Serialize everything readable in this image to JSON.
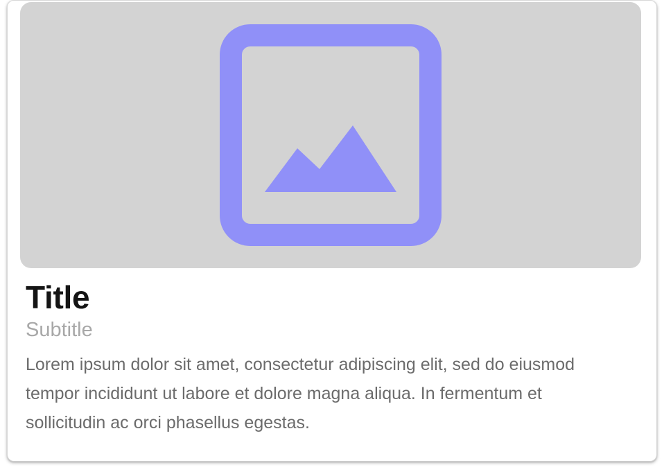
{
  "card": {
    "title": "Title",
    "subtitle": "Subtitle",
    "body": "Lorem ipsum dolor sit amet, consectetur adipiscing elit, sed do eiusmod tempor incididunt ut labore et dolore magna aliqua. In fermentum et sollicitudin ac orci phasellus egestas.",
    "media": {
      "icon": "image-placeholder-icon"
    }
  },
  "colors": {
    "media_background": "#d3d3d3",
    "icon_accent": "#9090f8",
    "title_text": "#141414",
    "subtitle_text": "#a8a8a8",
    "body_text": "#6b6b6b"
  }
}
